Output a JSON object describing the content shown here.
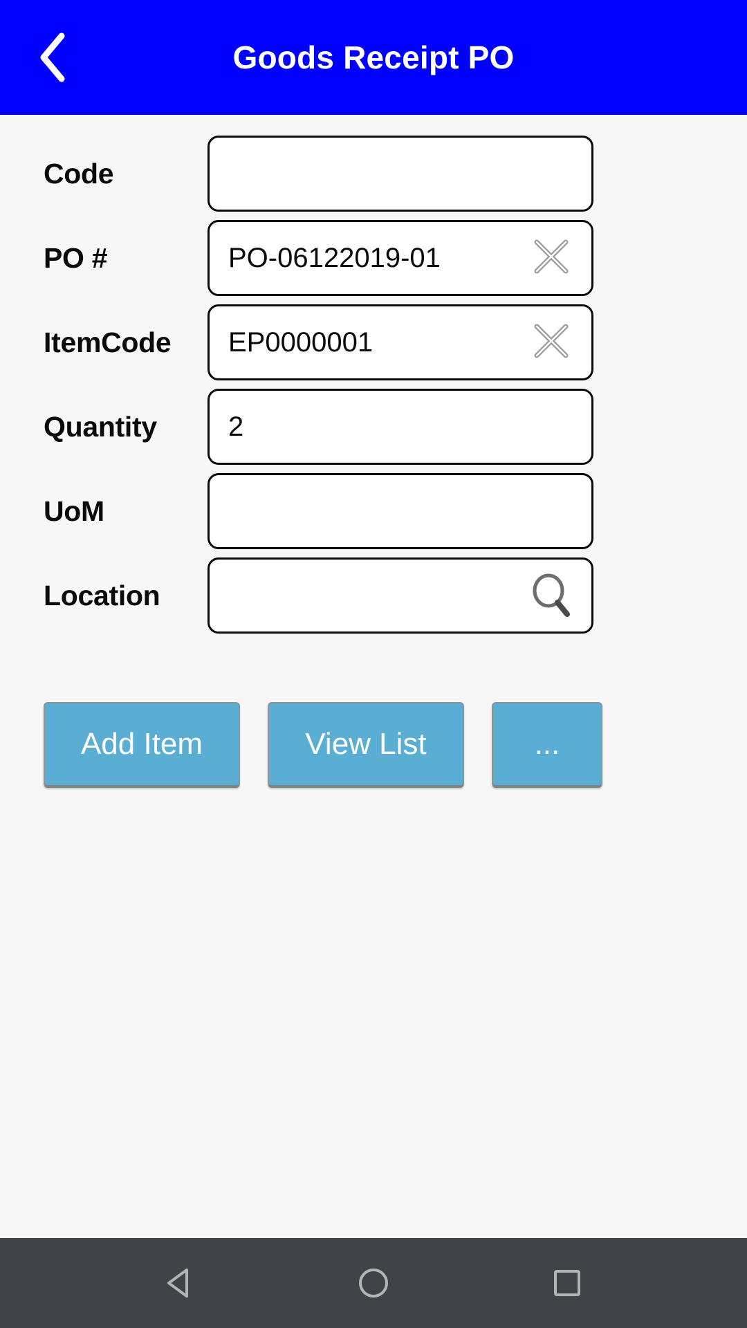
{
  "appbar": {
    "title": "Goods Receipt PO",
    "back_icon": "chevron-left-icon",
    "background_color": "#0000FF",
    "text_color": "#FFFFFF"
  },
  "form": {
    "fields": [
      {
        "label": "Code",
        "value": "",
        "placeholder": "",
        "icon": "none"
      },
      {
        "label": "PO #",
        "value": "PO-06122019-01",
        "placeholder": "",
        "icon": "clear-x-icon"
      },
      {
        "label": "ItemCode",
        "value": "EP0000001",
        "placeholder": "",
        "icon": "clear-x-icon"
      },
      {
        "label": "Quantity",
        "value": "2",
        "placeholder": "",
        "icon": "none"
      },
      {
        "label": "UoM",
        "value": "",
        "placeholder": "",
        "icon": "none"
      },
      {
        "label": "Location",
        "value": "",
        "placeholder": "",
        "icon": "search-icon"
      }
    ]
  },
  "buttons": {
    "add_item": "Add Item",
    "view_list": "View List",
    "more": "...",
    "color": "#5AAED4",
    "text_color": "#FFFFFF"
  },
  "navbar": {
    "back": "back-triangle-icon",
    "home": "home-circle-icon",
    "recents": "recents-square-icon",
    "background_color": "#3F4347",
    "icon_color": "#B0B4B7"
  }
}
